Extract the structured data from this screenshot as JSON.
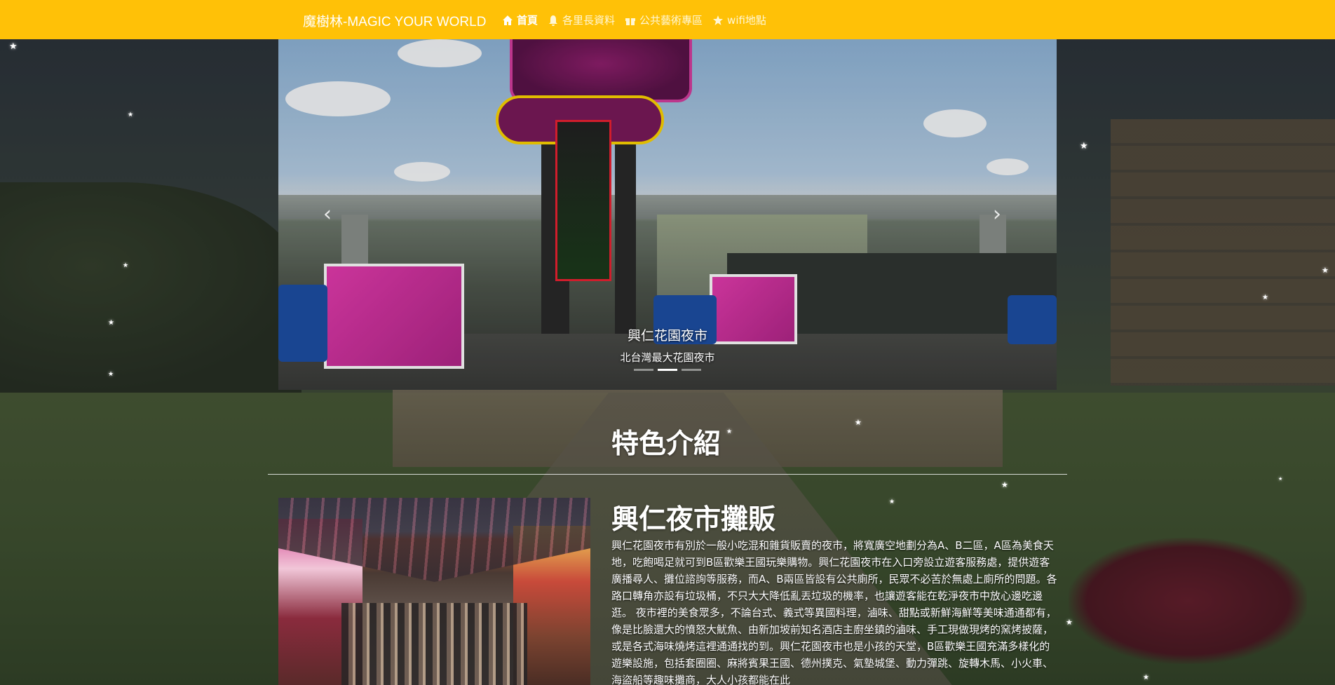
{
  "navbar": {
    "brand": "魔樹林-MAGIC YOUR WORLD",
    "items": [
      {
        "label": "首頁",
        "icon": "home-icon",
        "active": true
      },
      {
        "label": "各里長資料",
        "icon": "bell-icon",
        "active": false
      },
      {
        "label": "公共藝術專區",
        "icon": "gift-icon",
        "active": false
      },
      {
        "label": "wifi地點",
        "icon": "star-icon",
        "active": false
      }
    ],
    "color": "#ffc107"
  },
  "carousel": {
    "caption_title": "興仁花園夜市",
    "caption_subtitle": "北台灣最大花園夜市",
    "prev_icon": "chevron-left-icon",
    "next_icon": "chevron-right-icon",
    "indicator_count": 3,
    "active_indicator": 1
  },
  "section": {
    "title": "特色介紹"
  },
  "feature": {
    "title": "興仁夜市攤販",
    "body": "興仁花園夜市有別於一般小吃混和雜貨販賣的夜市，將寬廣空地劃分為A、B二區，A區為美食天地，吃飽喝足就可到B區歡樂王國玩樂購物。興仁花園夜市在入口旁設立遊客服務處，提供遊客廣播尋人、攤位諮詢等服務，而A、B兩區皆設有公共廁所，民眾不必苦於無處上廁所的問題。各路口轉角亦設有垃圾桶，不只大大降低亂丟垃圾的機率，也讓遊客能在乾淨夜市中放心邊吃邊逛。 夜市裡的美食眾多，不論台式、義式等異國料理，滷味、甜點或新鮮海鮮等美味通通都有，像是比臉還大的憤怒大魷魚、由新加坡前知名酒店主廚坐鎮的滷味、手工現做現烤的窯烤披薩，或是各式海味燒烤這裡通通找的到。興仁花園夜市也是小孩的天堂，B區歡樂王國充滿多樣化的遊樂設施，包括套圈圈、麻將賓果王國、德州撲克、氣墊城堡、動力彈跳、旋轉木馬、小火車、海盜船等趣味攤商，大人小孩都能在此"
  }
}
